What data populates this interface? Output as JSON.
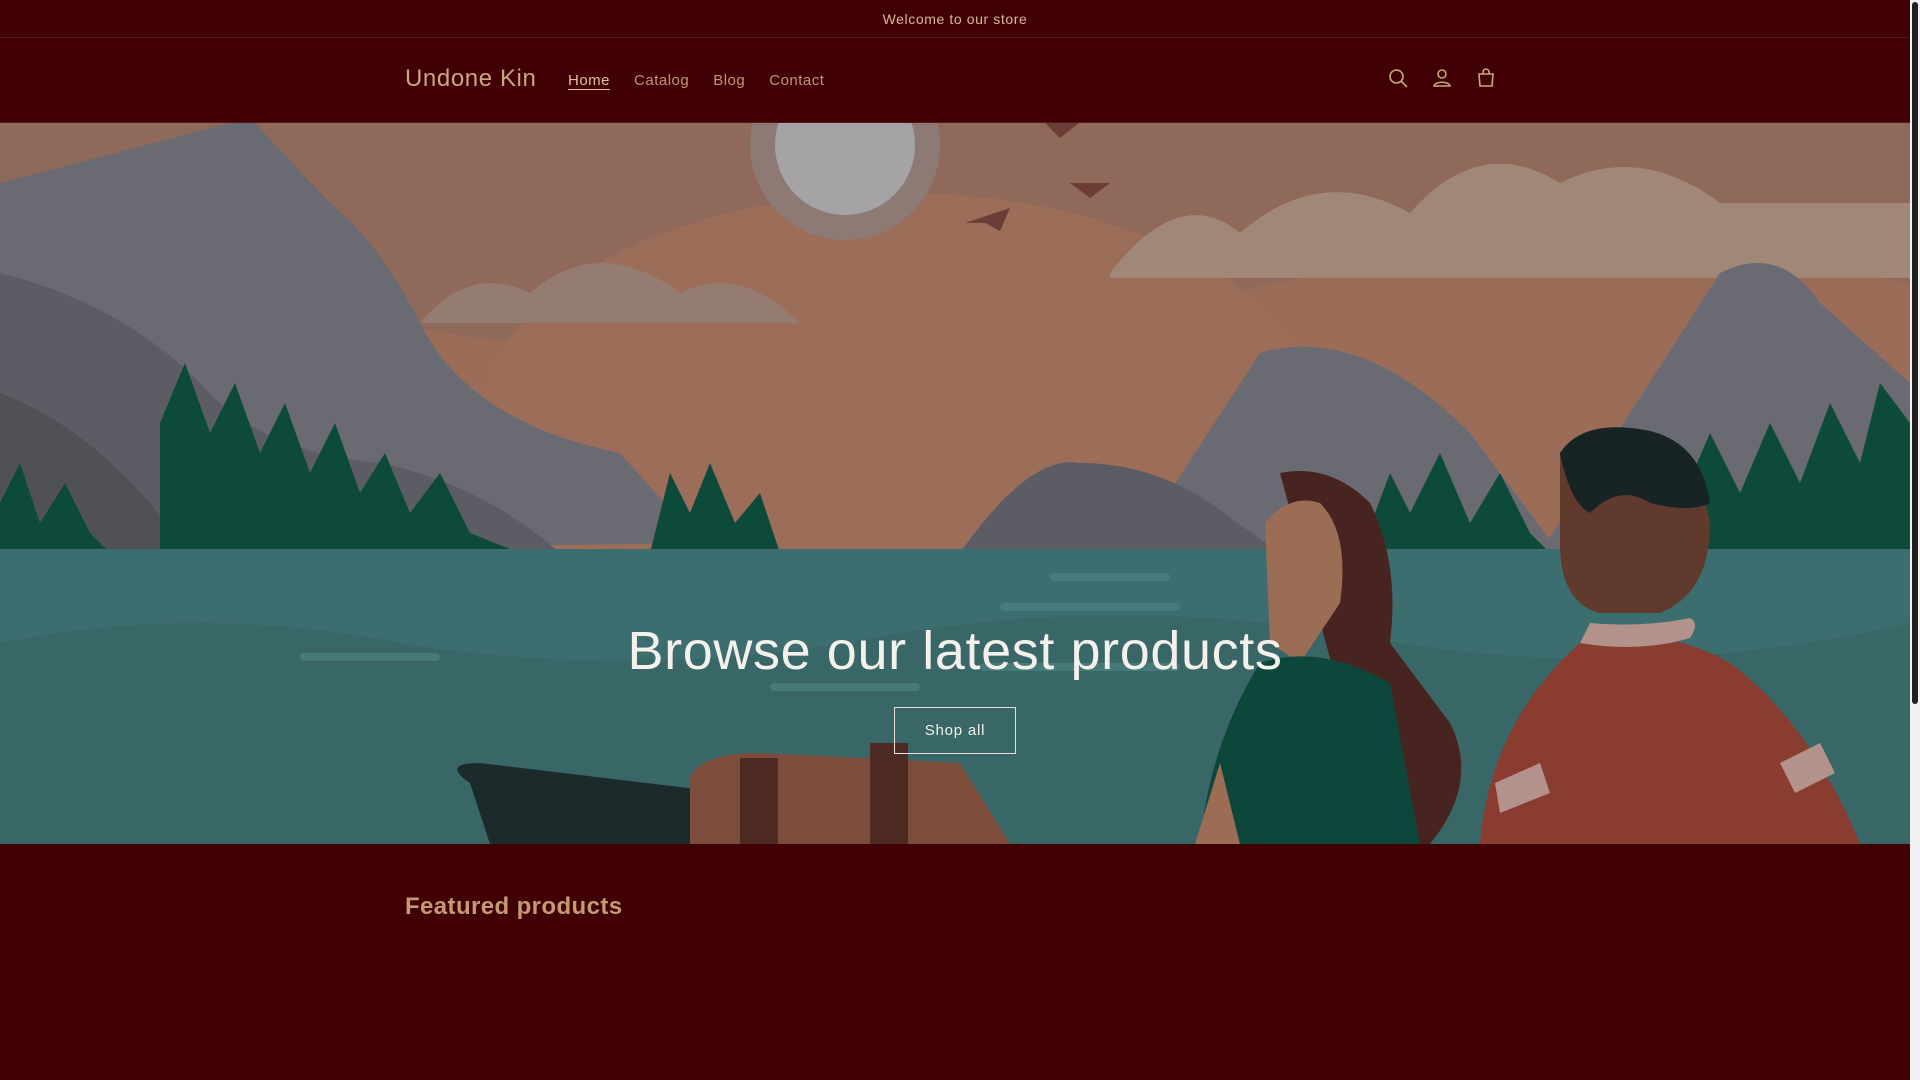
{
  "announcement": {
    "text": "Welcome to our store"
  },
  "header": {
    "logo": "Undone Kin",
    "nav": [
      {
        "label": "Home",
        "active": true
      },
      {
        "label": "Catalog",
        "active": false
      },
      {
        "label": "Blog",
        "active": false
      },
      {
        "label": "Contact",
        "active": false
      }
    ],
    "icons": [
      "search-icon",
      "account-icon",
      "cart-icon"
    ]
  },
  "hero": {
    "title": "Browse our latest products",
    "button_label": "Shop all"
  },
  "featured": {
    "title": "Featured products"
  },
  "colors": {
    "background": "#400004",
    "accent_text": "#c9a77f",
    "hero_text": "#f4f0ec",
    "water": "#3d6e6f",
    "sky": "#8f6a5a"
  }
}
